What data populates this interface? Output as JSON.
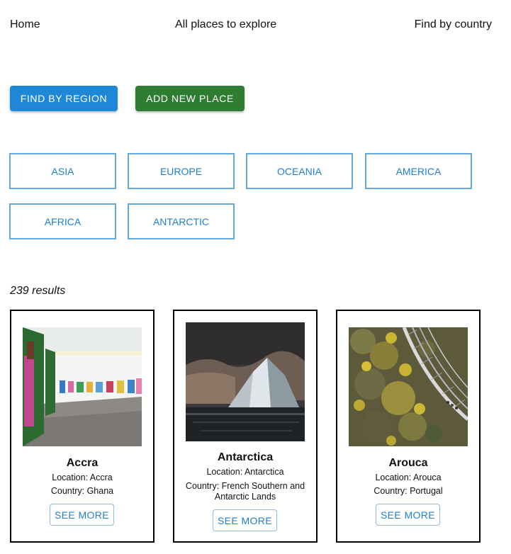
{
  "nav": {
    "home": "Home",
    "all_places": "All places to explore",
    "find_by_country": "Find by country"
  },
  "actions": {
    "find_by_region": "FIND BY REGION",
    "add_new_place": "ADD NEW PLACE"
  },
  "regions": [
    "ASIA",
    "EUROPE",
    "OCEANIA",
    "AMERICA",
    "AFRICA",
    "ANTARCTIC"
  ],
  "results_text": "239 results",
  "cards": [
    {
      "title": "Accra",
      "location": "Location: Accra",
      "country": "Country: Ghana",
      "button": "SEE MORE",
      "image": "art-gallery-photo"
    },
    {
      "title": "Antarctica",
      "location": "Location: Antarctica",
      "country": "Country: French Southern and Antarctic Lands",
      "button": "SEE MORE",
      "image": "iceberg-photo"
    },
    {
      "title": "Arouca",
      "location": "Location: Arouca",
      "country": "Country: Portugal",
      "button": "SEE MORE",
      "image": "suspension-bridge-photo"
    }
  ],
  "colors": {
    "primary": "#1e88d6",
    "success": "#2e7d32",
    "outline": "#64a8e0"
  }
}
